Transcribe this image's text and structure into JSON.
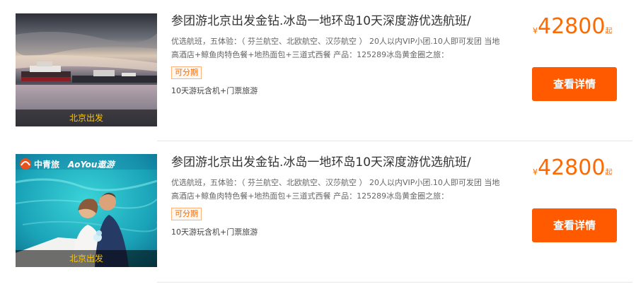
{
  "colors": {
    "accent": "#ff5a00",
    "price": "#ff6a00",
    "caption": "#ffc600"
  },
  "products": [
    {
      "title": "参团游北京出发金钻.冰岛一地环岛10天深度游优选航班/",
      "desc": "优选航班，五体验：（ 芬兰航空、北欧航空、汉莎航空 ） 20人以内VIP小团.10人即可发团 当地高酒店+鲸鱼肉特色餐+地热面包+三道式西餐 产品：125289冰岛黄金圈之旅：",
      "tag": "可分期",
      "subinfo": "10天游玩含机+门票旅游",
      "price_currency": "¥",
      "price": "42800",
      "price_suffix": "起",
      "button_label": "查看详情",
      "thumb_caption": "北京出发",
      "thumb_icon": "harbor-ship-photo"
    },
    {
      "title": "参团游北京出发金钻.冰岛一地环岛10天深度游优选航班/",
      "desc": "优选航班，五体验：（ 芬兰航空、北欧航空、汉莎航空 ） 20人以内VIP小团.10人即可发团 当地高酒店+鲸鱼肉特色餐+地热面包+三道式西餐 产品：125289冰岛黄金圈之旅：",
      "tag": "可分期",
      "subinfo": "10天游玩含机+门票旅游",
      "price_currency": "¥",
      "price": "42800",
      "price_suffix": "起",
      "button_label": "查看详情",
      "thumb_caption": "北京出发",
      "thumb_logo_cn": "中青旅",
      "thumb_logo_en": "AoYou遨游",
      "thumb_icon": "couple-boat-photo"
    }
  ]
}
